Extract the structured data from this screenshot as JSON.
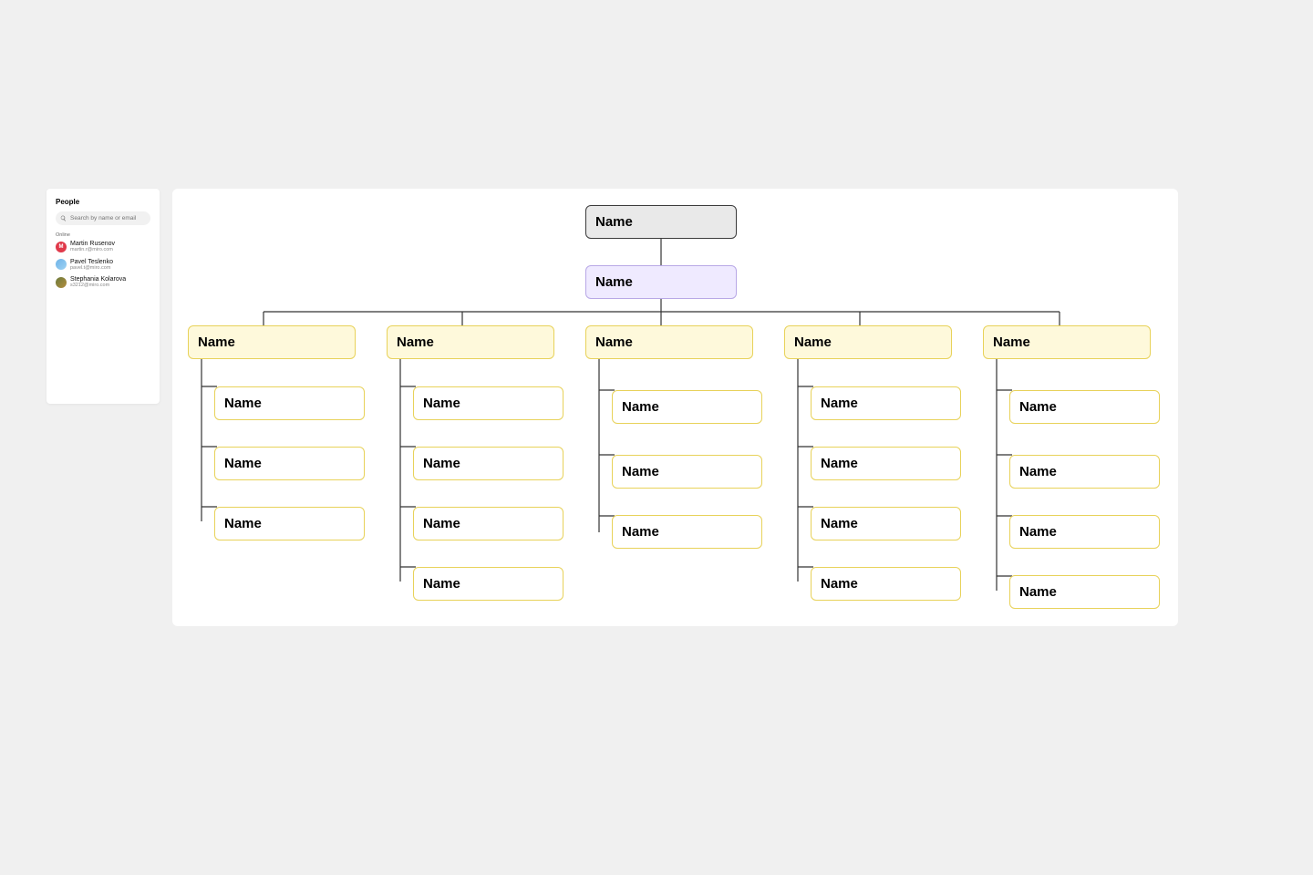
{
  "people_panel": {
    "title": "People",
    "search_placeholder": "Search by name or email",
    "section_label": "Online",
    "people": [
      {
        "name": "Martin Rusenov",
        "email": "martin.r@miro.com"
      },
      {
        "name": "Pavel Teslenko",
        "email": "pavel.t@miro.com"
      },
      {
        "name": "Stephania Kolarova",
        "email": "s3212@miro.com"
      }
    ]
  },
  "chart": {
    "root": "Name",
    "sub": "Name",
    "branches": [
      {
        "team": "Name",
        "members": [
          "Name",
          "Name",
          "Name"
        ]
      },
      {
        "team": "Name",
        "members": [
          "Name",
          "Name",
          "Name",
          "Name"
        ]
      },
      {
        "team": "Name",
        "members": [
          "Name",
          "Name",
          "Name"
        ]
      },
      {
        "team": "Name",
        "members": [
          "Name",
          "Name",
          "Name",
          "Name"
        ]
      },
      {
        "team": "Name",
        "members": [
          "Name",
          "Name",
          "Name",
          "Name"
        ]
      }
    ]
  },
  "colors": {
    "root_bg": "#e9e9e9",
    "sub_bg": "#efeaff",
    "team_bg": "#fef9db",
    "team_border": "#e8d25a",
    "sub_border": "#b8a8e6"
  }
}
